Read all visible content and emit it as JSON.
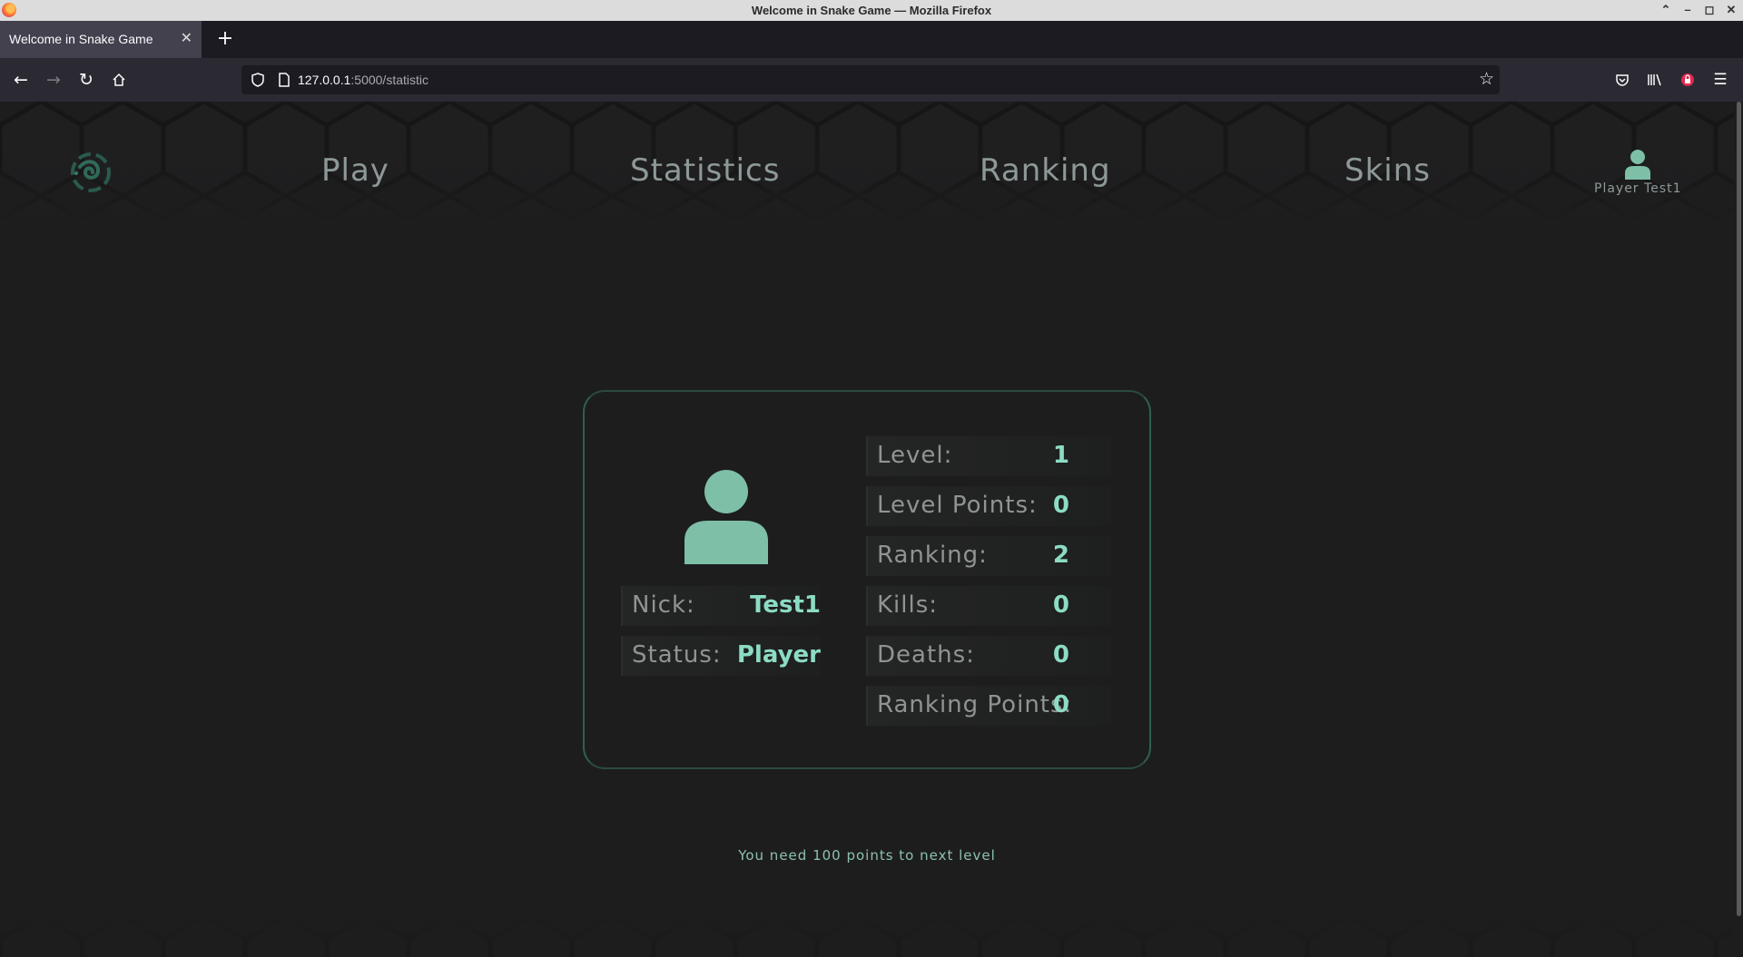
{
  "window": {
    "title": "Welcome in Snake Game — Mozilla Firefox"
  },
  "browser": {
    "tab_title": "Welcome in Snake Game",
    "url_host": "127.0.0.1",
    "url_path": ":5000/statistic",
    "icons": [
      "back-icon",
      "forward-icon",
      "reload-icon",
      "home-icon",
      "shield-icon",
      "page-icon",
      "bookmark-star-icon",
      "pocket-icon",
      "library-icon",
      "extension-icon",
      "menu-icon"
    ]
  },
  "nav": {
    "play": "Play",
    "statistics": "Statistics",
    "ranking": "Ranking",
    "skins": "Skins",
    "profile_name": "Player Test1"
  },
  "profile": {
    "nick_label": "Nick:",
    "nick_value": "Test1",
    "status_label": "Status:",
    "status_value": "Player"
  },
  "stats": [
    {
      "label": "Level:",
      "value": "1"
    },
    {
      "label": "Level Points:",
      "value": "0"
    },
    {
      "label": "Ranking:",
      "value": "2"
    },
    {
      "label": "Kills:",
      "value": "0"
    },
    {
      "label": "Deaths:",
      "value": "0"
    },
    {
      "label": "Ranking Points:",
      "value": "0"
    }
  ],
  "footer_message": "You need 100 points to next level",
  "colors": {
    "accent": "#8cdcc4",
    "avatar": "#7dbfa7",
    "background": "#1d1d1e",
    "nav_text": "#8e9997"
  }
}
